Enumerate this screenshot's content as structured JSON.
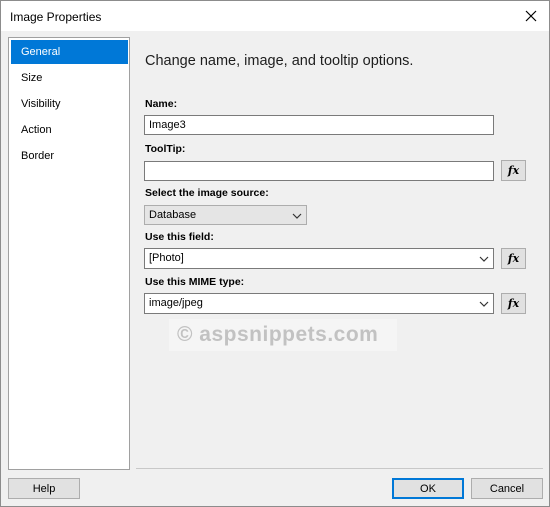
{
  "window": {
    "title": "Image Properties",
    "close_icon": "close-icon"
  },
  "nav": {
    "items": [
      {
        "label": "General",
        "selected": true
      },
      {
        "label": "Size",
        "selected": false
      },
      {
        "label": "Visibility",
        "selected": false
      },
      {
        "label": "Action",
        "selected": false
      },
      {
        "label": "Border",
        "selected": false
      }
    ]
  },
  "main": {
    "heading": "Change name, image, and tooltip options.",
    "name": {
      "label": "Name:",
      "value": "Image3"
    },
    "tooltip": {
      "label": "ToolTip:",
      "value": ""
    },
    "source": {
      "label": "Select the image source:",
      "value": "Database"
    },
    "field": {
      "label": "Use this field:",
      "value": "[Photo]"
    },
    "mime": {
      "label": "Use this MIME type:",
      "value": "image/jpeg"
    },
    "fx_label": "fx"
  },
  "watermark": "© aspsnippets.com",
  "footer": {
    "help_label": "Help",
    "ok_label": "OK",
    "cancel_label": "Cancel"
  },
  "colors": {
    "accent": "#0078d7",
    "background": "#f0f0f0"
  }
}
